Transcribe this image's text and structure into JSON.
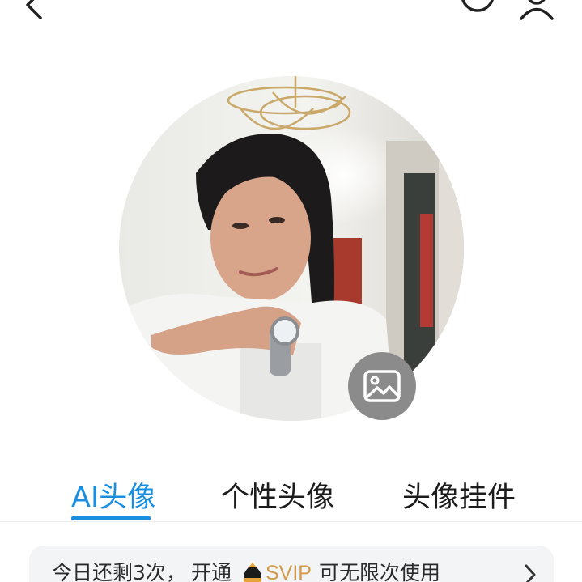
{
  "header": {
    "back_icon": "back-arrow-icon",
    "history_icon": "history-clock-icon",
    "profile_icon": "person-icon"
  },
  "avatar": {
    "change_icon": "image-icon"
  },
  "tabs": [
    {
      "label": "AI头像",
      "active": true
    },
    {
      "label": "个性头像",
      "active": false
    },
    {
      "label": "头像挂件",
      "active": false
    }
  ],
  "promo": {
    "text_start": "今日还剩3次，",
    "text_open": "开通",
    "badge": "SVIP",
    "text_end": "可无限次使用",
    "chevron_icon": "chevron-right-icon"
  },
  "colors": {
    "accent": "#1a8fe0",
    "svip_gold": "#d39a4c",
    "icon_button_bg": "#8b8b8b"
  }
}
